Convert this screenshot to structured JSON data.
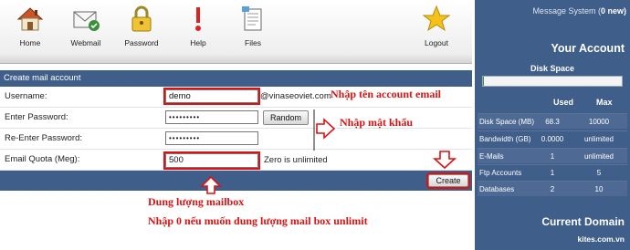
{
  "toolbar": {
    "home": "Home",
    "webmail": "Webmail",
    "password": "Password",
    "help": "Help",
    "files": "Files",
    "logout": "Logout"
  },
  "form": {
    "header": "Create mail account",
    "username_label": "Username:",
    "username_value": "demo",
    "domain_suffix": "@vinaseoviet.com",
    "password_label": "Enter Password:",
    "password_value": "•••••••••",
    "random_label": "Random",
    "repassword_label": "Re-Enter Password:",
    "repassword_value": "•••••••••",
    "quota_label": "Email Quota (Meg):",
    "quota_value": "500",
    "quota_hint": "Zero is unlimited",
    "create_label": "Create"
  },
  "annotations": {
    "account": "Nhập tên account email",
    "password": "Nhập mật khẩu",
    "quota_line1": "Dung lượng mailbox",
    "quota_line2": "Nhập 0 nếu muốn dung lượng mail box unlimit"
  },
  "sidebar": {
    "message_prefix": "Message System (",
    "message_count": "0",
    "message_suffix": " new)",
    "title": "Your Account",
    "disk_space": "Disk Space",
    "disk_fill_fraction": 0.007,
    "col_used": "Used",
    "col_max": "Max",
    "rows": [
      {
        "name": "Disk Space (MB)",
        "used": "68.3",
        "max": "10000"
      },
      {
        "name": "Bandwidth (GB)",
        "used": "0.0000",
        "max": "unlimited"
      },
      {
        "name": "E-Mails",
        "used": "1",
        "max": "unlimited"
      },
      {
        "name": "Ftp Accounts",
        "used": "1",
        "max": "5"
      },
      {
        "name": "Databases",
        "used": "2",
        "max": "10"
      }
    ],
    "current_domain_title": "Current Domain",
    "domain": "kites.com.vn"
  },
  "colors": {
    "panel_blue": "#3f5e89",
    "annotation_red": "#d81414"
  }
}
